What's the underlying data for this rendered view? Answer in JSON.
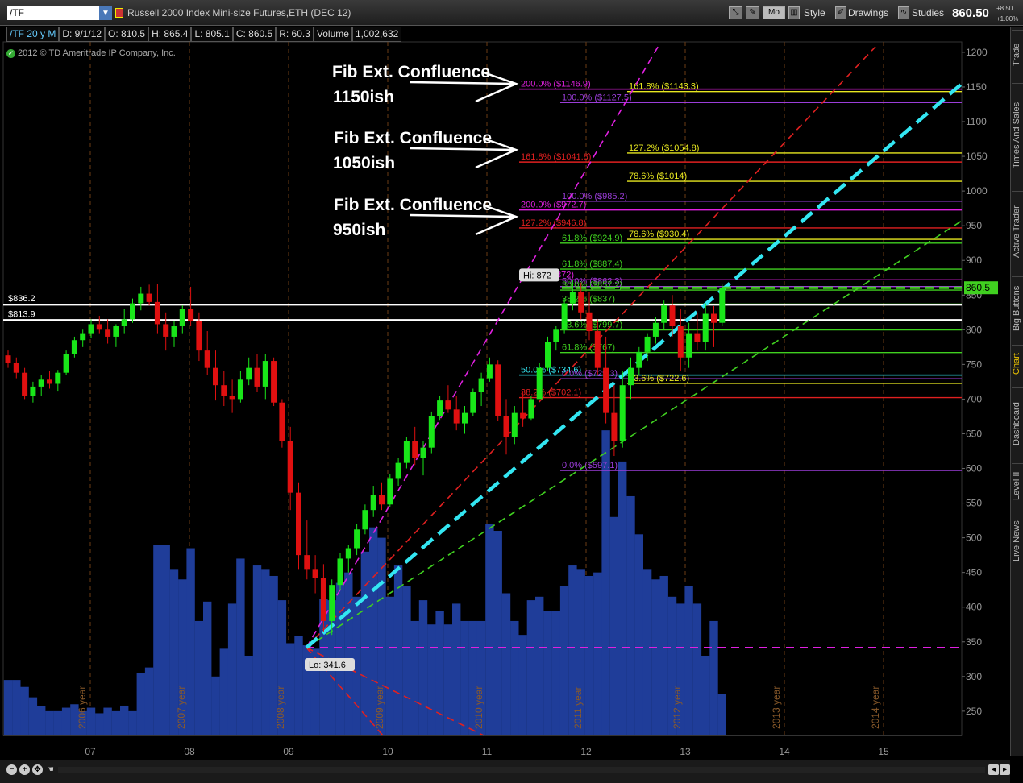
{
  "toolbar": {
    "symbol": "/TF",
    "title": "Russell 2000 Index Mini-size Futures,ETH (DEC 12)",
    "mode_button": "Mo",
    "style_label": "Style",
    "drawings_label": "Drawings",
    "studies_label": "Studies",
    "last_price": "860.50",
    "change_abs": "+8.50",
    "change_pct": "+1.00%"
  },
  "info": {
    "symbol": "/TF 20 y M",
    "date": "D: 9/1/12",
    "open": "O: 810.5",
    "high": "H: 865.4",
    "low": "L: 805.1",
    "close": "C: 860.5",
    "range": "R: 60.3",
    "volume_label": "Volume",
    "volume": "1,002,632"
  },
  "copyright": "2012 © TD Ameritrade IP Company, Inc.",
  "side_tabs": [
    "Trade",
    "Times And Sales",
    "Active Trader",
    "Big Buttons",
    "Chart",
    "Dashboard",
    "Level II",
    "Live News"
  ],
  "colors": {
    "up": "#19e619",
    "down": "#e01010",
    "volume": "#1f3d99",
    "grid": "#6b3d14",
    "trend_cyan": "#33e6f2",
    "magenta": "#e020e0",
    "fib_purple": "#9a3dd8",
    "fib_green": "#40d020",
    "fib_red": "#e02020",
    "fib_yellow": "#e8e820"
  },
  "chart_data": {
    "type": "candlestick",
    "y_range": [
      215,
      1215
    ],
    "y_ticks": [
      "1200",
      "1150",
      "1100",
      "1050",
      "1000",
      "950",
      "900",
      "850",
      "800",
      "750",
      "700",
      "650",
      "600",
      "550",
      "500",
      "450",
      "400",
      "350",
      "300",
      "250"
    ],
    "x_labels": [
      "07",
      "08",
      "09",
      "10",
      "11",
      "12",
      "13",
      "14",
      "15"
    ],
    "year_labels": [
      "2006 year",
      "2007 year",
      "2008 year",
      "2009 year",
      "2010 year",
      "2011 year",
      "2012 year",
      "2013 year",
      "2014 year"
    ],
    "candles": [
      [
        763,
        770,
        745,
        752
      ],
      [
        752,
        760,
        730,
        738
      ],
      [
        738,
        745,
        700,
        705
      ],
      [
        705,
        725,
        695,
        718
      ],
      [
        718,
        735,
        705,
        728
      ],
      [
        728,
        740,
        715,
        722
      ],
      [
        722,
        742,
        712,
        738
      ],
      [
        738,
        770,
        735,
        765
      ],
      [
        765,
        790,
        760,
        785
      ],
      [
        785,
        800,
        775,
        795
      ],
      [
        795,
        815,
        788,
        808
      ],
      [
        808,
        820,
        795,
        800
      ],
      [
        800,
        815,
        780,
        790
      ],
      [
        790,
        808,
        775,
        805
      ],
      [
        805,
        830,
        795,
        815
      ],
      [
        815,
        845,
        810,
        838
      ],
      [
        838,
        862,
        828,
        852
      ],
      [
        852,
        865,
        835,
        840
      ],
      [
        840,
        866,
        795,
        808
      ],
      [
        808,
        825,
        770,
        790
      ],
      [
        790,
        812,
        775,
        805
      ],
      [
        805,
        835,
        795,
        830
      ],
      [
        830,
        862,
        805,
        812
      ],
      [
        812,
        825,
        755,
        770
      ],
      [
        770,
        798,
        735,
        745
      ],
      [
        745,
        770,
        698,
        720
      ],
      [
        720,
        740,
        690,
        705
      ],
      [
        705,
        728,
        680,
        700
      ],
      [
        700,
        740,
        695,
        728
      ],
      [
        728,
        760,
        720,
        745
      ],
      [
        745,
        765,
        710,
        718
      ],
      [
        718,
        765,
        700,
        755
      ],
      [
        755,
        760,
        690,
        695
      ],
      [
        695,
        700,
        630,
        640
      ],
      [
        640,
        660,
        540,
        565
      ],
      [
        565,
        580,
        455,
        475
      ],
      [
        475,
        525,
        440,
        455
      ],
      [
        455,
        475,
        420,
        442
      ],
      [
        442,
        462,
        365,
        380
      ],
      [
        380,
        440,
        360,
        432
      ],
      [
        432,
        478,
        425,
        470
      ],
      [
        470,
        490,
        450,
        485
      ],
      [
        485,
        520,
        475,
        512
      ],
      [
        512,
        548,
        505,
        540
      ],
      [
        540,
        575,
        530,
        562
      ],
      [
        562,
        580,
        540,
        548
      ],
      [
        548,
        592,
        545,
        585
      ],
      [
        585,
        615,
        575,
        608
      ],
      [
        608,
        645,
        600,
        640
      ],
      [
        640,
        660,
        605,
        615
      ],
      [
        615,
        640,
        590,
        630
      ],
      [
        630,
        682,
        622,
        675
      ],
      [
        675,
        705,
        670,
        698
      ],
      [
        698,
        720,
        680,
        685
      ],
      [
        685,
        705,
        655,
        665
      ],
      [
        665,
        690,
        650,
        680
      ],
      [
        680,
        715,
        675,
        710
      ],
      [
        710,
        738,
        690,
        730
      ],
      [
        730,
        760,
        725,
        750
      ],
      [
        750,
        756,
        668,
        675
      ],
      [
        675,
        700,
        620,
        645
      ],
      [
        645,
        690,
        635,
        680
      ],
      [
        680,
        712,
        660,
        672
      ],
      [
        672,
        705,
        670,
        700
      ],
      [
        700,
        752,
        700,
        745
      ],
      [
        745,
        790,
        740,
        782
      ],
      [
        782,
        805,
        770,
        800
      ],
      [
        800,
        845,
        795,
        838
      ],
      [
        838,
        872,
        828,
        855
      ],
      [
        855,
        868,
        815,
        825
      ],
      [
        825,
        855,
        785,
        798
      ],
      [
        798,
        815,
        735,
        745
      ],
      [
        745,
        790,
        665,
        680
      ],
      [
        680,
        720,
        618,
        640
      ],
      [
        640,
        740,
        630,
        720
      ],
      [
        720,
        760,
        700,
        745
      ],
      [
        745,
        775,
        735,
        768
      ],
      [
        768,
        795,
        755,
        790
      ],
      [
        790,
        818,
        780,
        810
      ],
      [
        810,
        842,
        800,
        835
      ],
      [
        835,
        850,
        790,
        805
      ],
      [
        805,
        830,
        740,
        760
      ],
      [
        760,
        810,
        745,
        795
      ],
      [
        795,
        825,
        770,
        782
      ],
      [
        782,
        838,
        770,
        823
      ],
      [
        823,
        834,
        775,
        810
      ],
      [
        810,
        865,
        805,
        860
      ]
    ],
    "volume": [
      295,
      295,
      285,
      270,
      257,
      250,
      250,
      255,
      260,
      250,
      255,
      247,
      255,
      250,
      258,
      250,
      305,
      313,
      490,
      490,
      455,
      440,
      485,
      380,
      408,
      300,
      340,
      405,
      470,
      330,
      460,
      455,
      445,
      410,
      348,
      358,
      345,
      340,
      412,
      410,
      435,
      450,
      415,
      480,
      515,
      500,
      415,
      460,
      430,
      380,
      410,
      375,
      395,
      375,
      405,
      380,
      380,
      380,
      520,
      510,
      420,
      380,
      360,
      410,
      415,
      395,
      395,
      430,
      460,
      455,
      445,
      450,
      655,
      530,
      610,
      560,
      505,
      455,
      440,
      445,
      415,
      405,
      430,
      405,
      330,
      380,
      275
    ],
    "fib_levels": [
      {
        "price": 1146.9,
        "label": "200.0%  ($1146.9)",
        "color": "magenta"
      },
      {
        "price": 1143.3,
        "label": "161.8%  ($1143.3)",
        "color": "yellow"
      },
      {
        "price": 1127.5,
        "label": "100.0%  ($1127.5)",
        "color": "purple"
      },
      {
        "price": 1054.8,
        "label": "127.2%  ($1054.8)",
        "color": "yellow"
      },
      {
        "price": 1041.8,
        "label": "161.8%  ($1041.8)",
        "color": "red"
      },
      {
        "price": 1014,
        "label": "78.6%  ($1014)",
        "color": "yellow"
      },
      {
        "price": 985.2,
        "label": "100.0%  ($985.2)",
        "color": "purple"
      },
      {
        "price": 972.7,
        "label": "200.0%  ($972.7)",
        "color": "magenta"
      },
      {
        "price": 946.8,
        "label": "127.2%  ($946.8)",
        "color": "red"
      },
      {
        "price": 930.4,
        "label": "78.6%  ($930.4)",
        "color": "yellow"
      },
      {
        "price": 924.9,
        "label": "61.8%  ($924.9)",
        "color": "green"
      },
      {
        "price": 887.4,
        "label": "61.8%  ($887.4)",
        "color": "green"
      },
      {
        "price": 872,
        "label": "50.0%  ($872)",
        "color": "magenta"
      },
      {
        "price": 862.3,
        "label": "50.0%  ($862.3)",
        "color": "purple"
      },
      {
        "price": 857.2,
        "label": "30.0%  ($857.2)",
        "color": "green"
      },
      {
        "price": 837,
        "label": "38.2%  ($837)",
        "color": "green"
      },
      {
        "price": 799.7,
        "label": "23.6%  ($799.7)",
        "color": "green"
      },
      {
        "price": 767,
        "label": "61.8%  ($767)",
        "color": "green"
      },
      {
        "price": 734.6,
        "label": "50.0%  ($734.6)",
        "color": "cyan"
      },
      {
        "price": 729.3,
        "label": "0.0%  ($729.3)",
        "color": "purple"
      },
      {
        "price": 722.6,
        "label": "23.6%  ($722.6)",
        "color": "yellow"
      },
      {
        "price": 702.1,
        "label": "38.2%  ($702.1)",
        "color": "red"
      },
      {
        "price": 597.1,
        "label": "0.0%  ($597.1)",
        "color": "purple"
      }
    ],
    "hlines": [
      {
        "price": 836.2,
        "label": "$836.2"
      },
      {
        "price": 813.9,
        "label": "$813.9"
      }
    ],
    "hi_label": "Hi: 872",
    "lo_label": "Lo: 341.6",
    "current_price_tag": "860.5",
    "annotations": [
      {
        "line1": "Fib Ext. Confluence",
        "line2": "1150ish"
      },
      {
        "line1": "Fib Ext. Confluence",
        "line2": "1050ish"
      },
      {
        "line1": "Fib Ext. Confluence",
        "line2": "950ish"
      }
    ]
  }
}
